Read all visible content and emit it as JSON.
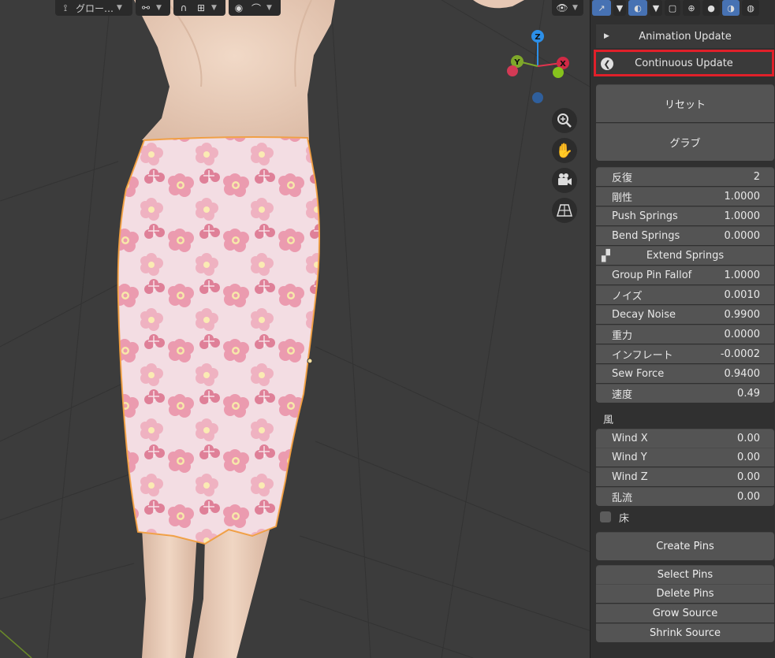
{
  "viewport": {
    "toolbar": [
      {
        "icon": "transform-orientation-icon",
        "label": "グロー…"
      },
      {
        "icon": "snap-link-icon",
        "label": ""
      },
      {
        "icon": "snap-magnet-icon",
        "label": ""
      },
      {
        "icon": "proportional-edit-icon",
        "label": ""
      }
    ],
    "axes": {
      "z": "Z",
      "y": "Y",
      "x": "X"
    }
  },
  "panel": {
    "animation_update": "Animation Update",
    "continuous_update": "Continuous Update",
    "reset_button": "リセット",
    "grab_button": "グラブ",
    "params": [
      {
        "label": "反復",
        "value": "2"
      },
      {
        "label": "剛性",
        "value": "1.0000"
      },
      {
        "label": "Push Springs",
        "value": "1.0000"
      },
      {
        "label": "Bend Springs",
        "value": "0.0000"
      }
    ],
    "extend_springs": "Extend Springs",
    "params2": [
      {
        "label": "Group Pin Fallof",
        "value": "1.0000"
      },
      {
        "label": "ノイズ",
        "value": "0.0010"
      },
      {
        "label": "Decay Noise",
        "value": "0.9900"
      },
      {
        "label": "重力",
        "value": "0.0000"
      },
      {
        "label": "インフレート",
        "value": "-0.0002"
      },
      {
        "label": "Sew Force",
        "value": "0.9400"
      },
      {
        "label": "速度",
        "value": "0.49"
      }
    ],
    "wind_label": "風",
    "wind": [
      {
        "label": "Wind X",
        "value": "0.00"
      },
      {
        "label": "Wind Y",
        "value": "0.00"
      },
      {
        "label": "Wind Z",
        "value": "0.00"
      },
      {
        "label": "乱流",
        "value": "0.00"
      }
    ],
    "floor_label": "床",
    "create_pins": "Create Pins",
    "pin_buttons": [
      "Select Pins",
      "Delete Pins",
      "Grow Source",
      "Shrink Source"
    ]
  },
  "colors": {
    "highlight": "#e0202a",
    "selection_outline": "#f09a3a",
    "accent": "#4772b3"
  }
}
